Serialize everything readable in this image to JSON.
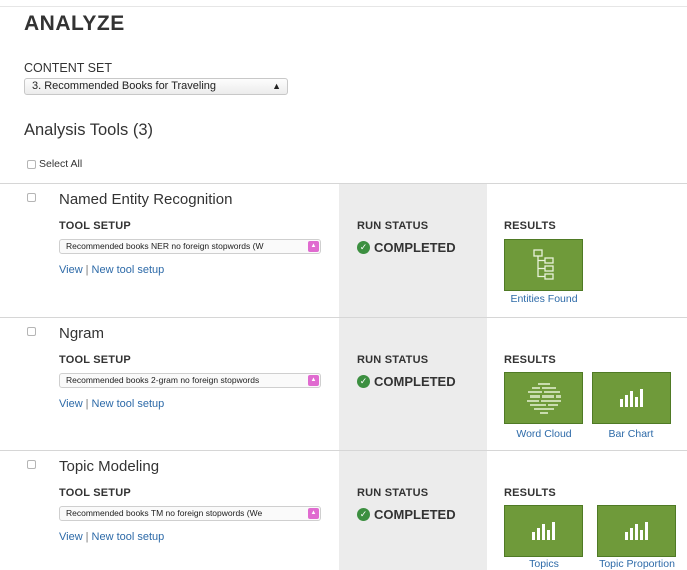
{
  "page": {
    "title": "ANALYZE"
  },
  "content_set": {
    "label": "CONTENT SET",
    "selected": "3. Recommended Books for Traveling"
  },
  "tools_section": {
    "title": "Analysis Tools (3)",
    "select_all_label": "Select All"
  },
  "column_headers": {
    "setup": "TOOL SETUP",
    "status": "RUN STATUS",
    "results": "RESULTS"
  },
  "links": {
    "view": "View",
    "separator": "|",
    "new_setup": "New tool setup"
  },
  "tools": [
    {
      "name": "Named Entity Recognition",
      "setup_selected": "Recommended books NER no foreign stopwords (W",
      "status": "COMPLETED",
      "results": [
        {
          "label": "Entities Found",
          "icon": "tree-icon"
        }
      ]
    },
    {
      "name": "Ngram",
      "setup_selected": "Recommended books 2-gram no foreign stopwords",
      "status": "COMPLETED",
      "results": [
        {
          "label": "Word Cloud",
          "icon": "word-cloud-icon"
        },
        {
          "label": "Bar Chart",
          "icon": "bar-chart-icon"
        }
      ]
    },
    {
      "name": "Topic Modeling",
      "setup_selected": "Recommended books TM no foreign stopwords (We",
      "status": "COMPLETED",
      "results": [
        {
          "label": "Topics",
          "icon": "bar-chart-icon"
        },
        {
          "label": "Topic Proportion",
          "icon": "bar-chart-icon"
        }
      ]
    }
  ],
  "colors": {
    "tile_green": "#6f9a3a",
    "link_blue": "#2d6aa8",
    "status_green": "#3c8f40",
    "select_arrow_pink": "#e06bd0",
    "status_band": "#ececec"
  }
}
